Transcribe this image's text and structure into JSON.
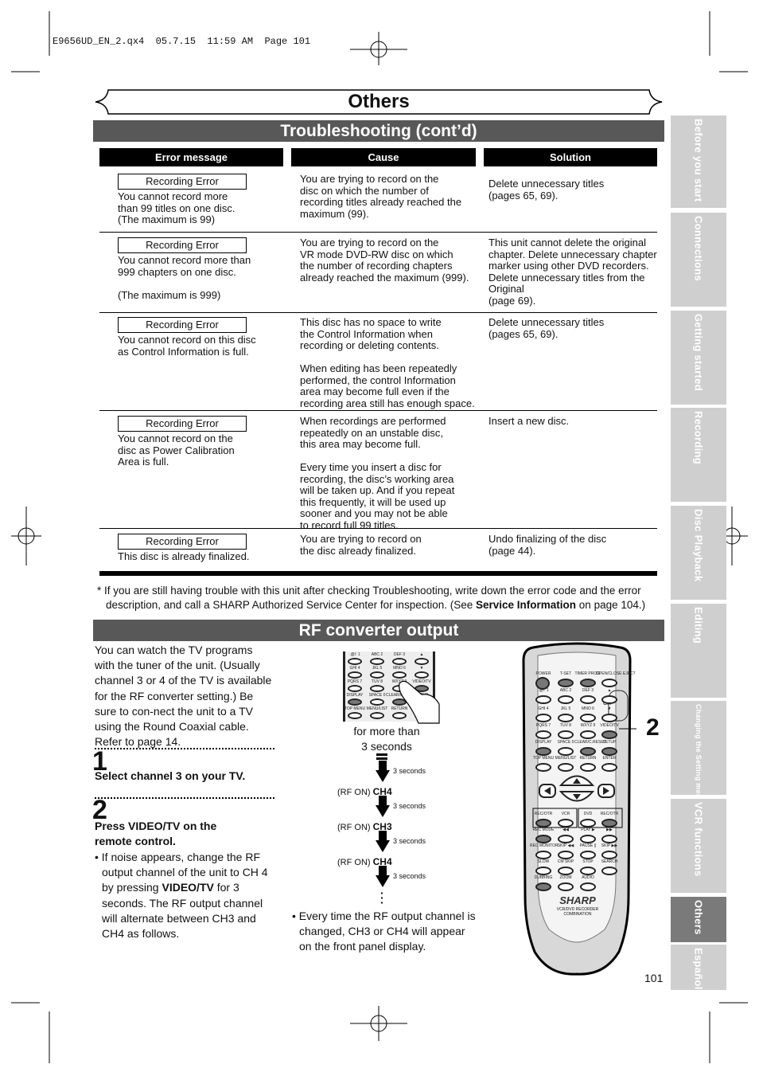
{
  "slug": "E9656UD_EN_2.qx4  05.7.15  11:59 AM  Page 101",
  "chapter_title": "Others",
  "troubleshooting": {
    "title": "Troubleshooting (cont’d)",
    "columns": [
      "Error message",
      "Cause",
      "Solution"
    ],
    "rows": [
      {
        "error_label": "Recording Error",
        "error_text": "You cannot record more\nthan 99 titles on one disc.\n(The maximum is 99)",
        "cause": "You are trying to record on the\ndisc on which the number of\nrecording titles already reached the\nmaximum (99).",
        "solution": "Delete unnecessary titles\n(pages 65, 69)."
      },
      {
        "error_label": "Recording Error",
        "error_text": "You cannot record more than\n999 chapters on one disc.\n\n(The maximum is 999)",
        "cause": "You are trying to record on the\nVR mode DVD-RW disc on which\nthe number of recording chapters\nalready reached the maximum (999).",
        "solution": "This unit cannot delete the original\nchapter. Delete unnecessary chapter\nmarker using other DVD recorders.\nDelete unnecessary titles from the\nOriginal\n(page 69)."
      },
      {
        "error_label": "Recording Error",
        "error_text": "You cannot record on this disc\nas Control Information is full.",
        "cause": "This disc has no space to write\nthe Control Information when\nrecording or deleting contents.\n\nWhen editing has been repeatedly\nperformed, the control Information\narea may become full even if the\nrecording area still has enough space.",
        "solution": "Delete unnecessary titles\n(pages 65, 69)."
      },
      {
        "error_label": "Recording Error",
        "error_text": "You cannot record on the\ndisc as Power Calibration\nArea is full.",
        "cause": "When recordings are performed\nrepeatedly on an unstable disc,\nthis area may become full.\n\nEvery time you insert a disc for\nrecording, the disc’s working area\nwill be taken up.  And if you repeat\nthis frequently, it will be used up\nsooner and you may not be able\nto record full 99 titles.",
        "solution": "Insert a new disc."
      },
      {
        "error_label": "Recording Error",
        "error_text": "This disc is already finalized.",
        "cause": "You are trying to record on\nthe disc already finalized.",
        "solution": "Undo finalizing of the disc\n(page 44)."
      }
    ],
    "footnote_a": "* If you are still having trouble with this unit after checking Troubleshooting, write down the error code and the error",
    "footnote_b": "description, and call a SHARP Authorized Service Center for inspection. (See ",
    "footnote_bold": "Service Information",
    "footnote_c": " on page 104.)"
  },
  "rf": {
    "title": "RF converter output",
    "intro": "You can watch the TV programs with the tuner of the unit. (Usually channel 3 or 4 of the TV is available for the RF converter setting.) Be sure to con-nect the unit to a TV using the Round Coaxial cable. Refer to page 14.",
    "step1_num": "1",
    "step1_text": "Select channel 3 on your TV.",
    "step2_num": "2",
    "step2_text": "Press VIDEO/TV on the remote control.",
    "step2_bullet_a": "• If noise appears, change the RF output channel of the unit to CH 4 by pressing ",
    "step2_bullet_bold": "VIDEO/TV",
    "step2_bullet_b": " for 3 seconds. The RF output channel will alternate between CH3 and CH4 as follows.",
    "hold_caption": "for more than\n3 seconds",
    "sequence": [
      {
        "prefix": "",
        "channel": "",
        "interval": "3 seconds"
      },
      {
        "prefix": "(RF ON) ",
        "channel": "CH4",
        "interval": "3 seconds"
      },
      {
        "prefix": "(RF ON) ",
        "channel": "CH3",
        "interval": "3 seconds"
      },
      {
        "prefix": "(RF ON) ",
        "channel": "CH4",
        "interval": "3 seconds"
      }
    ],
    "note": "• Every time the RF output channel is changed, CH3 or CH4 will appear on the front panel display.",
    "callout": "2"
  },
  "remote": {
    "brand": "SHARP",
    "model": "VCR/DVD RECORDER\nCOMBINATION",
    "ch_label": "CH",
    "rows": [
      [
        "POWER",
        "T-SET",
        "TIMER PROG.",
        "OPEN/CLOSE EJECT"
      ],
      [
        ".@/: 1",
        "ABC 2",
        "DEF 3",
        "▲"
      ],
      [
        "GHI 4",
        "JKL 5",
        "MNO 6",
        "▼"
      ],
      [
        "PQRS 7",
        "TUV 8",
        "WXYZ 9",
        "VIDEO/TV"
      ],
      [
        "DISPLAY",
        "SPACE 0",
        "CLEAR/C.RESET",
        "SETUP"
      ],
      [
        "TOP MENU",
        "MENU/LIST",
        "RETURN",
        "ENTER"
      ],
      [
        "REC/OTR",
        "VCR",
        "DVD",
        "REC/OTR"
      ],
      [
        "REC MODE",
        "◀◀",
        "PLAY ▶",
        "▶▶"
      ],
      [
        "REC MONITOR",
        "SKIP ◀◀",
        "PAUSE ||",
        "SKIP ▶▶"
      ],
      [
        "SLOW",
        "CM SKIP",
        "STOP",
        "SEARCH"
      ],
      [
        "DUBBING",
        "ZOOM",
        "AUDIO"
      ]
    ]
  },
  "page_number": "101",
  "side_tabs": [
    {
      "label": "Before you start",
      "active": false
    },
    {
      "label": "Connections",
      "active": false
    },
    {
      "label": "Getting started",
      "active": false
    },
    {
      "label": "Recording",
      "active": false
    },
    {
      "label": "Disc Playback",
      "active": false
    },
    {
      "label": "Editing",
      "active": false
    },
    {
      "label": "Changing the Setting menu",
      "active": false
    },
    {
      "label": "VCR functions",
      "active": false
    },
    {
      "label": "Others",
      "active": true
    },
    {
      "label": "Español",
      "active": false
    }
  ]
}
